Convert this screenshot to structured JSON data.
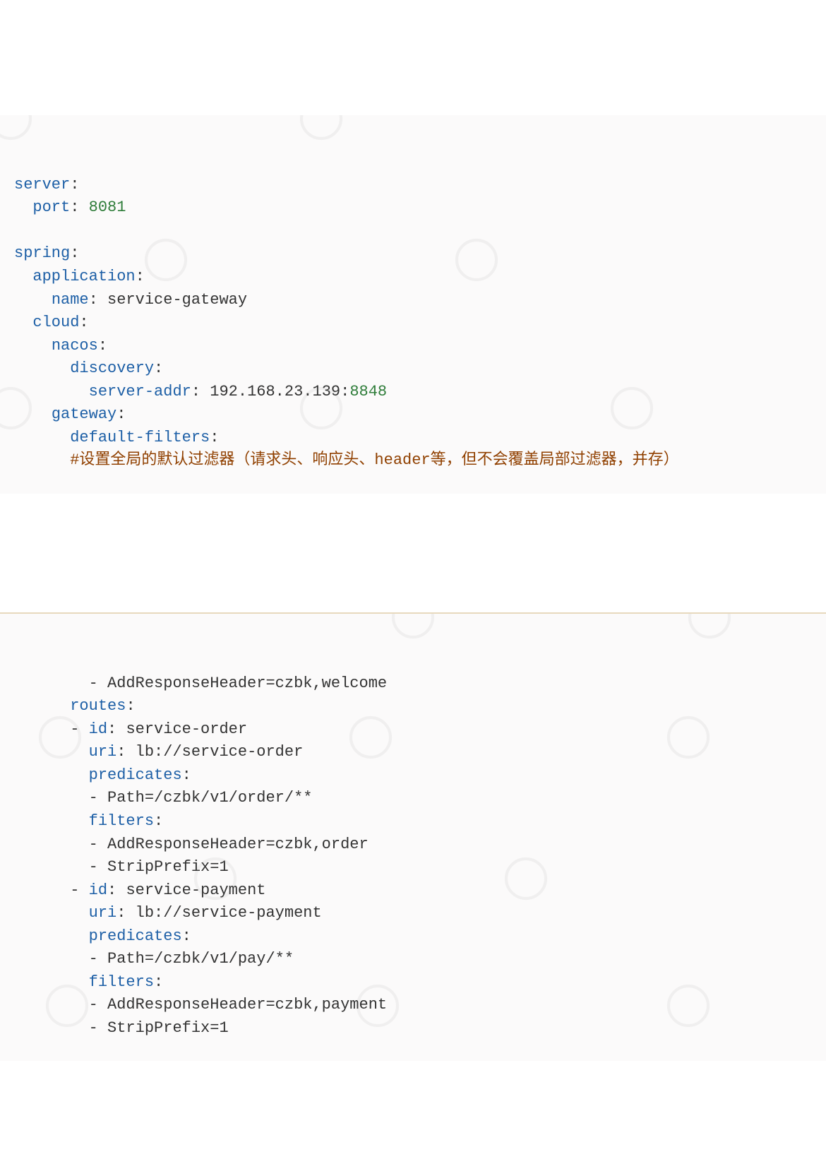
{
  "yaml": {
    "server": {
      "key_server": "server",
      "key_port": "port",
      "port_value": "8081"
    },
    "spring": {
      "key_spring": "spring",
      "key_application": "application",
      "key_name": "name",
      "name_value": "service-gateway",
      "key_cloud": "cloud",
      "key_nacos": "nacos",
      "key_discovery": "discovery",
      "key_server_addr": "server-addr",
      "server_addr_value": "192.168.23.139:",
      "server_addr_port": "8848",
      "key_gateway": "gateway",
      "key_default_filters": "default-filters",
      "comment": "#设置全局的默认过滤器（请求头、响应头、header等，但不会覆盖局部过滤器，并存）"
    },
    "lower": {
      "add_resp_welcome": "- AddResponseHeader=czbk,welcome",
      "key_routes": "routes",
      "r0": {
        "dash_id": "- ",
        "key_id": "id",
        "id_value": "service-order",
        "key_uri": "uri",
        "uri_value": "lb://service-order",
        "key_predicates": "predicates",
        "pred_path": "- Path=/czbk/v1/order/**",
        "key_filters": "filters",
        "filt_add": "- AddResponseHeader=czbk,order",
        "filt_strip": "- StripPrefix=1"
      },
      "r1": {
        "dash_id": "- ",
        "key_id": "id",
        "id_value": "service-payment",
        "key_uri": "uri",
        "uri_value": "lb://service-payment",
        "key_predicates": "predicates",
        "pred_path": "- Path=/czbk/v1/pay/**",
        "key_filters": "filters",
        "filt_add": "- AddResponseHeader=czbk,payment",
        "filt_strip": "- StripPrefix=1"
      }
    }
  }
}
